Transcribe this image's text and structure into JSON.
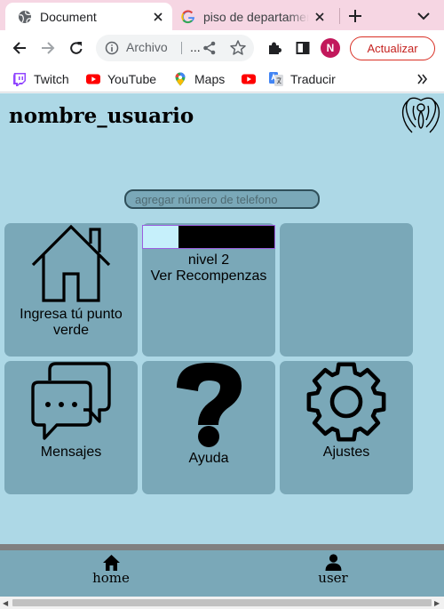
{
  "browser": {
    "tabs": [
      {
        "title": "Document",
        "active": true,
        "icon": "globe-icon"
      },
      {
        "title": "piso de departamento",
        "active": false,
        "icon": "google-icon"
      }
    ],
    "omnibox": {
      "chip": "Archivo",
      "url": "..."
    },
    "profile_initial": "N",
    "update_label": "Actualizar",
    "bookmarks": [
      {
        "label": "Twitch",
        "icon": "twitch-icon"
      },
      {
        "label": "YouTube",
        "icon": "youtube-icon"
      },
      {
        "label": "Maps",
        "icon": "maps-icon"
      },
      {
        "label": "",
        "icon": "youtube-icon"
      },
      {
        "label": "Traducir",
        "icon": "translate-icon"
      }
    ]
  },
  "page": {
    "username": "nombre_usuario",
    "phone_placeholder": "agregar número de telefono",
    "cards": {
      "green_point": "Ingresa tú punto verde",
      "level": "nivel 2",
      "rewards": "Ver Recompenzas",
      "messages": "Mensajes",
      "help": "Ayuda",
      "settings": "Ajustes"
    },
    "level_progress": 0.27,
    "colors": {
      "page_bg": "#add8e6",
      "card_bg": "#7aa8b8",
      "progress_fill": "#c6f0fb"
    },
    "footer": {
      "home": "home",
      "user": "user"
    }
  }
}
